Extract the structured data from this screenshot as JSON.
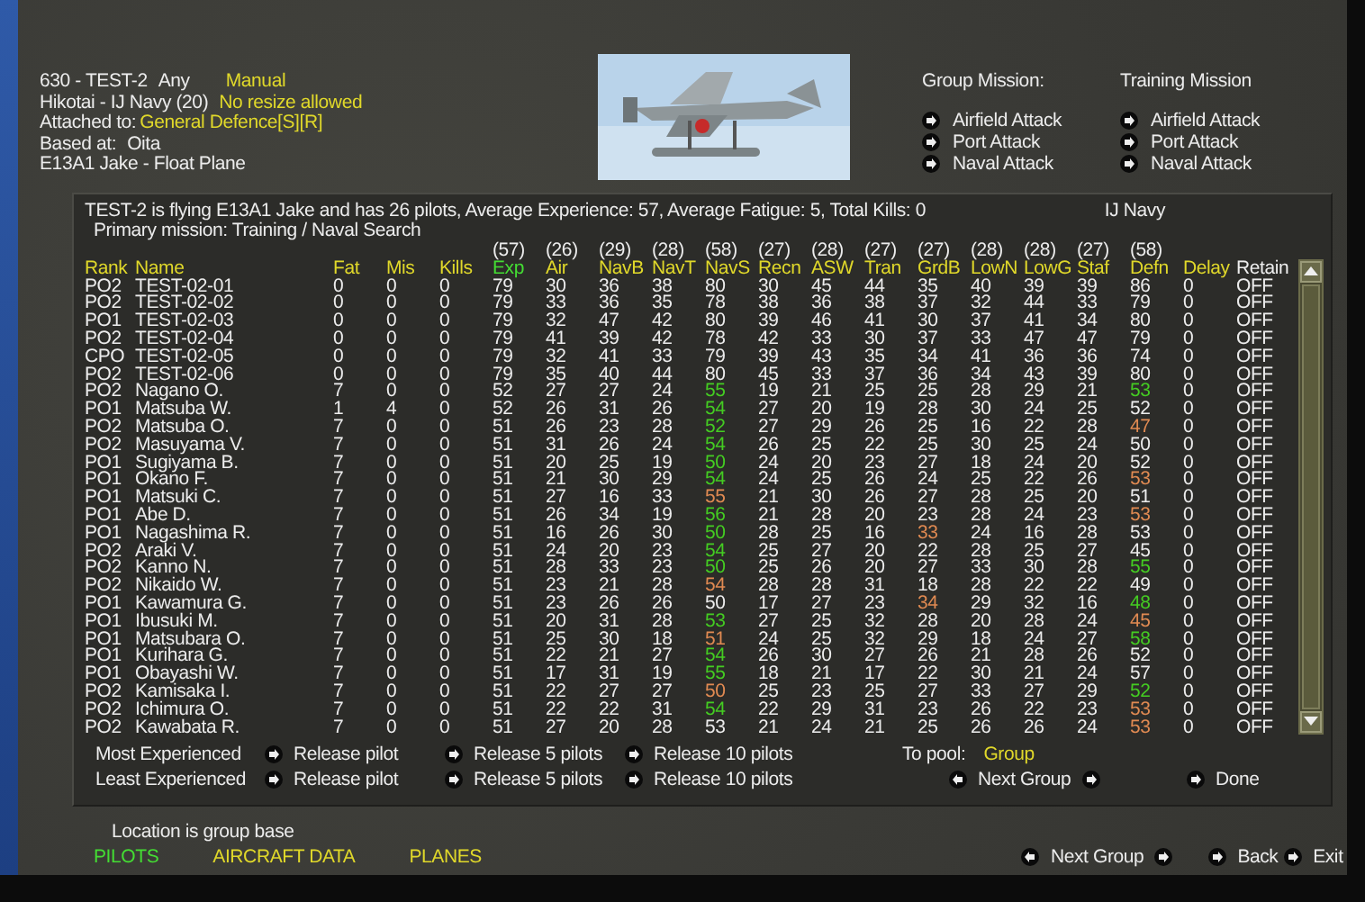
{
  "header": {
    "unit": "630 - TEST-2",
    "filter": "Any",
    "mode": "Manual",
    "hikotai": "Hikotai - IJ Navy (20)",
    "resize_note": "No resize allowed",
    "attached_label": "Attached to:",
    "attached_value": "General Defence[S][R]",
    "based_label": "Based at:",
    "based_value": "Oita",
    "aircraft": "E13A1 Jake - Float Plane"
  },
  "missions": [
    {
      "title": "Group Mission:",
      "items": [
        "Airfield Attack",
        "Port Attack",
        "Naval Attack"
      ]
    },
    {
      "title": "Training Mission",
      "items": [
        "Airfield Attack",
        "Port Attack",
        "Naval Attack"
      ]
    }
  ],
  "panel": {
    "summary": "TEST-2  is flying E13A1 Jake and has 26 pilots,  Average Experience: 57,  Average Fatigue: 5,  Total Kills: 0",
    "service": "IJ Navy",
    "primary_mission": "Primary mission: Training / Naval Search",
    "averages": [
      "(57)",
      "(26)",
      "(29)",
      "(28)",
      "(58)",
      "(27)",
      "(28)",
      "(27)",
      "(27)",
      "(28)",
      "(28)",
      "(27)",
      "(58)"
    ],
    "columns": [
      {
        "label": "Rank",
        "color": "#e0d82a"
      },
      {
        "label": "Name",
        "color": "#e0d82a"
      },
      {
        "label": "Fat",
        "color": "#e0d82a"
      },
      {
        "label": "Mis",
        "color": "#e0d82a"
      },
      {
        "label": "Kills",
        "color": "#e0d82a"
      },
      {
        "label": "Exp",
        "color": "#44dd33"
      },
      {
        "label": "Air",
        "color": "#e0d82a"
      },
      {
        "label": "NavB",
        "color": "#e0d82a"
      },
      {
        "label": "NavT",
        "color": "#e0d82a"
      },
      {
        "label": "NavS",
        "color": "#e0d82a"
      },
      {
        "label": "Recn",
        "color": "#e0d82a"
      },
      {
        "label": "ASW",
        "color": "#e0d82a"
      },
      {
        "label": "Tran",
        "color": "#e0d82a"
      },
      {
        "label": "GrdB",
        "color": "#e0d82a"
      },
      {
        "label": "LowN",
        "color": "#e0d82a"
      },
      {
        "label": "LowG",
        "color": "#e0d82a"
      },
      {
        "label": "Staf",
        "color": "#e0d82a"
      },
      {
        "label": "Defn",
        "color": "#e0d82a"
      },
      {
        "label": "Delay",
        "color": "#e0d82a"
      },
      {
        "label": "Retain",
        "color": "#eeeeee"
      }
    ],
    "rows": [
      {
        "cells": [
          "PO2",
          "TEST-02-01",
          "0",
          "0",
          "0",
          "79",
          "30",
          "36",
          "38",
          "80",
          "30",
          "45",
          "44",
          "35",
          "40",
          "39",
          "39",
          "86",
          "0",
          "OFF"
        ]
      },
      {
        "cells": [
          "PO2",
          "TEST-02-02",
          "0",
          "0",
          "0",
          "79",
          "33",
          "36",
          "35",
          "78",
          "38",
          "36",
          "38",
          "37",
          "32",
          "44",
          "33",
          "79",
          "0",
          "OFF"
        ]
      },
      {
        "cells": [
          "PO1",
          "TEST-02-03",
          "0",
          "0",
          "0",
          "79",
          "32",
          "47",
          "42",
          "80",
          "39",
          "46",
          "41",
          "30",
          "37",
          "41",
          "34",
          "80",
          "0",
          "OFF"
        ]
      },
      {
        "cells": [
          "PO2",
          "TEST-02-04",
          "0",
          "0",
          "0",
          "79",
          "41",
          "39",
          "42",
          "78",
          "42",
          "33",
          "30",
          "37",
          "33",
          "47",
          "47",
          "79",
          "0",
          "OFF"
        ]
      },
      {
        "cells": [
          "CPO",
          "TEST-02-05",
          "0",
          "0",
          "0",
          "79",
          "32",
          "41",
          "33",
          "79",
          "39",
          "43",
          "35",
          "34",
          "41",
          "36",
          "36",
          "74",
          "0",
          "OFF"
        ]
      },
      {
        "cells": [
          "PO2",
          "TEST-02-06",
          "0",
          "0",
          "0",
          "79",
          "35",
          "40",
          "44",
          "80",
          "45",
          "33",
          "37",
          "36",
          "34",
          "43",
          "39",
          "80",
          "0",
          "OFF"
        ]
      },
      {
        "cells": [
          "PO2",
          "Nagano O.",
          "7",
          "0",
          "0",
          "52",
          "27",
          "27",
          "24",
          {
            "text": "55",
            "color": "#44cc22"
          },
          "19",
          "21",
          "25",
          "25",
          "28",
          "29",
          "21",
          {
            "text": "53",
            "color": "#44cc22"
          },
          "0",
          "OFF"
        ]
      },
      {
        "cells": [
          "PO1",
          "Matsuba W.",
          "1",
          "4",
          "0",
          "52",
          "26",
          "31",
          "26",
          {
            "text": "54",
            "color": "#44cc22"
          },
          "27",
          "20",
          "19",
          "28",
          "30",
          "24",
          "25",
          "52",
          "0",
          "OFF"
        ]
      },
      {
        "cells": [
          "PO2",
          "Matsuba O.",
          "7",
          "0",
          "0",
          "51",
          "26",
          "23",
          "28",
          {
            "text": "52",
            "color": "#44cc22"
          },
          "27",
          "29",
          "26",
          "25",
          "16",
          "22",
          "28",
          {
            "text": "47",
            "color": "#e08a52"
          },
          "0",
          "OFF"
        ]
      },
      {
        "cells": [
          "PO2",
          "Masuyama V.",
          "7",
          "0",
          "0",
          "51",
          "31",
          "26",
          "24",
          {
            "text": "54",
            "color": "#44cc22"
          },
          "26",
          "25",
          "22",
          "25",
          "30",
          "25",
          "24",
          "50",
          "0",
          "OFF"
        ]
      },
      {
        "cells": [
          "PO1",
          "Sugiyama B.",
          "7",
          "0",
          "0",
          "51",
          "20",
          "25",
          "19",
          {
            "text": "50",
            "color": "#44cc22"
          },
          "24",
          "20",
          "23",
          "27",
          "18",
          "24",
          "20",
          "52",
          "0",
          "OFF"
        ]
      },
      {
        "cells": [
          "PO1",
          "Okano F.",
          "7",
          "0",
          "0",
          "51",
          "21",
          "30",
          "29",
          {
            "text": "54",
            "color": "#44cc22"
          },
          "24",
          "25",
          "26",
          "24",
          "25",
          "22",
          "26",
          {
            "text": "53",
            "color": "#e08a52"
          },
          "0",
          "OFF"
        ]
      },
      {
        "cells": [
          "PO1",
          "Matsuki C.",
          "7",
          "0",
          "0",
          "51",
          "27",
          "16",
          "33",
          {
            "text": "55",
            "color": "#e08a52"
          },
          "21",
          "30",
          "26",
          "27",
          "28",
          "25",
          "20",
          "51",
          "0",
          "OFF"
        ]
      },
      {
        "cells": [
          "PO1",
          "Abe D.",
          "7",
          "0",
          "0",
          "51",
          "26",
          "34",
          "19",
          {
            "text": "56",
            "color": "#44cc22"
          },
          "21",
          "28",
          "20",
          "23",
          "28",
          "24",
          "23",
          {
            "text": "53",
            "color": "#e08a52"
          },
          "0",
          "OFF"
        ]
      },
      {
        "cells": [
          "PO1",
          "Nagashima R.",
          "7",
          "0",
          "0",
          "51",
          "16",
          "26",
          "30",
          {
            "text": "50",
            "color": "#44cc22"
          },
          "28",
          "25",
          "16",
          {
            "text": "33",
            "color": "#e08a52"
          },
          "24",
          "16",
          "28",
          "53",
          "0",
          "OFF"
        ]
      },
      {
        "cells": [
          "PO2",
          "Araki V.",
          "7",
          "0",
          "0",
          "51",
          "24",
          "20",
          "23",
          {
            "text": "54",
            "color": "#44cc22"
          },
          "25",
          "27",
          "20",
          "22",
          "28",
          "25",
          "27",
          "45",
          "0",
          "OFF"
        ]
      },
      {
        "cells": [
          "PO2",
          "Kanno N.",
          "7",
          "0",
          "0",
          "51",
          "28",
          "33",
          "23",
          {
            "text": "50",
            "color": "#44cc22"
          },
          "25",
          "26",
          "20",
          "27",
          "33",
          "30",
          "28",
          {
            "text": "55",
            "color": "#44cc22"
          },
          "0",
          "OFF"
        ]
      },
      {
        "cells": [
          "PO2",
          "Nikaido W.",
          "7",
          "0",
          "0",
          "51",
          "23",
          "21",
          "28",
          {
            "text": "54",
            "color": "#e08a52"
          },
          "28",
          "28",
          "31",
          "18",
          "28",
          "22",
          "22",
          "49",
          "0",
          "OFF"
        ]
      },
      {
        "cells": [
          "PO1",
          "Kawamura G.",
          "7",
          "0",
          "0",
          "51",
          "23",
          "26",
          "26",
          "50",
          "17",
          "27",
          "23",
          {
            "text": "34",
            "color": "#e08a52"
          },
          "29",
          "32",
          "16",
          {
            "text": "48",
            "color": "#44cc22"
          },
          "0",
          "OFF"
        ]
      },
      {
        "cells": [
          "PO1",
          "Ibusuki M.",
          "7",
          "0",
          "0",
          "51",
          "20",
          "31",
          "28",
          {
            "text": "53",
            "color": "#44cc22"
          },
          "27",
          "25",
          "32",
          "28",
          "20",
          "28",
          "24",
          {
            "text": "45",
            "color": "#e08a52"
          },
          "0",
          "OFF"
        ]
      },
      {
        "cells": [
          "PO1",
          "Matsubara O.",
          "7",
          "0",
          "0",
          "51",
          "25",
          "30",
          "18",
          {
            "text": "51",
            "color": "#e08a52"
          },
          "24",
          "25",
          "32",
          "29",
          "18",
          "24",
          "27",
          {
            "text": "58",
            "color": "#44cc22"
          },
          "0",
          "OFF"
        ]
      },
      {
        "cells": [
          "PO1",
          "Kurihara G.",
          "7",
          "0",
          "0",
          "51",
          "22",
          "21",
          "27",
          {
            "text": "54",
            "color": "#44cc22"
          },
          "26",
          "30",
          "27",
          "26",
          "21",
          "28",
          "26",
          "52",
          "0",
          "OFF"
        ]
      },
      {
        "cells": [
          "PO1",
          "Obayashi W.",
          "7",
          "0",
          "0",
          "51",
          "17",
          "31",
          "19",
          {
            "text": "55",
            "color": "#44cc22"
          },
          "18",
          "21",
          "17",
          "22",
          "30",
          "21",
          "24",
          "57",
          "0",
          "OFF"
        ]
      },
      {
        "cells": [
          "PO2",
          "Kamisaka I.",
          "7",
          "0",
          "0",
          "51",
          "22",
          "27",
          "27",
          {
            "text": "50",
            "color": "#e08a52"
          },
          "25",
          "23",
          "25",
          "27",
          "33",
          "27",
          "29",
          {
            "text": "52",
            "color": "#44cc22"
          },
          "0",
          "OFF"
        ]
      },
      {
        "cells": [
          "PO2",
          "Ichimura O.",
          "7",
          "0",
          "0",
          "51",
          "22",
          "22",
          "31",
          {
            "text": "54",
            "color": "#44cc22"
          },
          "22",
          "29",
          "31",
          "23",
          "26",
          "22",
          "23",
          {
            "text": "53",
            "color": "#e08a52"
          },
          "0",
          "OFF"
        ]
      },
      {
        "cells": [
          "PO2",
          "Kawabata R.",
          "7",
          "0",
          "0",
          "51",
          "27",
          "20",
          "28",
          "53",
          "21",
          "24",
          "21",
          "25",
          "26",
          "26",
          "24",
          {
            "text": "53",
            "color": "#e08a52"
          },
          "0",
          "OFF"
        ]
      }
    ],
    "release_rows": [
      {
        "label": "Most Experienced",
        "buttons": [
          "Release pilot",
          "Release 5 pilots",
          "Release 10 pilots"
        ]
      },
      {
        "label": "Least Experienced",
        "buttons": [
          "Release pilot",
          "Release 5 pilots",
          "Release 10 pilots"
        ]
      }
    ],
    "pool_label": "To pool:",
    "pool_value": "Group",
    "next_group": "Next Group",
    "done": "Done"
  },
  "location_note": "Location is group base",
  "screen_tabs": [
    {
      "label": "PILOTS",
      "selected": true
    },
    {
      "label": "AIRCRAFT DATA",
      "selected": false
    },
    {
      "label": "PLANES",
      "selected": false
    }
  ],
  "footer": {
    "next_group": "Next Group",
    "back": "Back",
    "exit": "Exit"
  }
}
